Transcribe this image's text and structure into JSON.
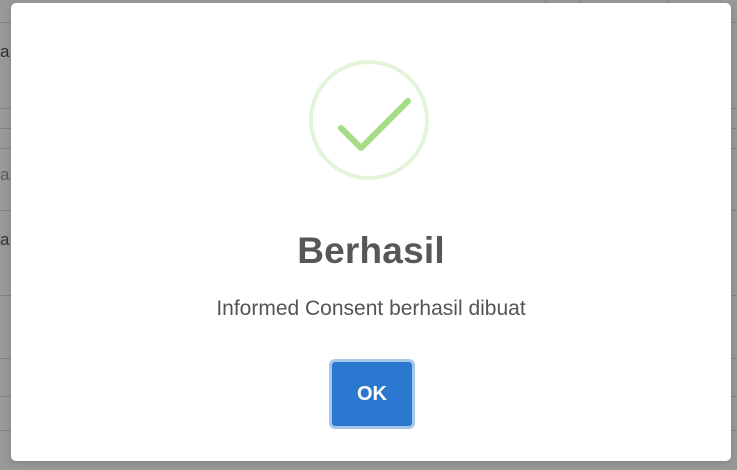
{
  "background": {
    "fragments": [
      "a",
      "a",
      "a"
    ]
  },
  "dialog": {
    "icon": "success-check-icon",
    "icon_color": "#a5dc86",
    "title": "Berhasil",
    "message": "Informed Consent berhasil dibuat",
    "confirm_label": "OK",
    "confirm_color": "#2a78cf"
  }
}
